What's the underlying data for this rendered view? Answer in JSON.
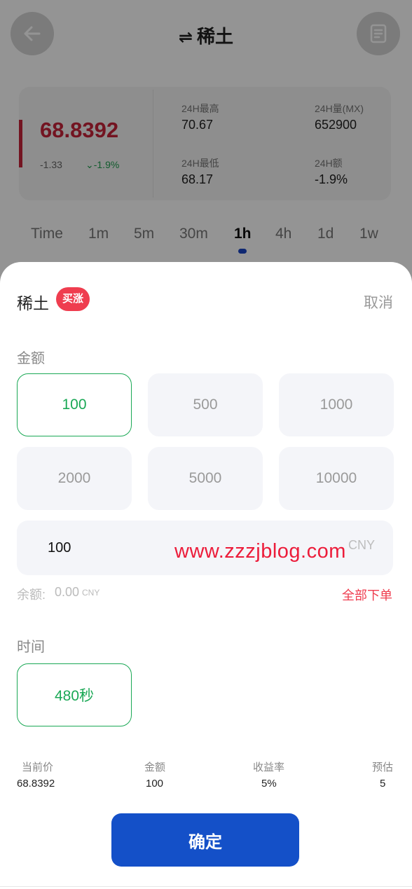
{
  "header": {
    "title": "稀土",
    "swap_glyph": "⇌",
    "back_icon": "arrow-left-icon",
    "orders_icon": "document-icon"
  },
  "ticker": {
    "price": "68.8392",
    "change_abs": "-1.33",
    "change_pct": "-1.9%",
    "change_arrow": "⌄",
    "stats": {
      "high_label": "24H最高",
      "high_value": "70.67",
      "volume_label": "24H量(MX)",
      "volume_value": "652900",
      "low_label": "24H最低",
      "low_value": "68.17",
      "amount_label": "24H额",
      "amount_value": "-1.9%"
    }
  },
  "intervals": [
    "Time",
    "1m",
    "5m",
    "30m",
    "1h",
    "4h",
    "1d",
    "1w"
  ],
  "active_interval": "1h",
  "sheet": {
    "title": "稀土",
    "badge": "买涨",
    "cancel": "取消",
    "amount_label": "金额",
    "amount_options": [
      "100",
      "500",
      "1000",
      "2000",
      "5000",
      "10000"
    ],
    "selected_amount": "100",
    "input_value": "100",
    "input_unit": "CNY",
    "watermark": "www.zzzjblog.com",
    "balance_label": "余额:",
    "balance_value": "0.00",
    "balance_unit": "CNY",
    "order_all": "全部下单",
    "time_label": "时间",
    "time_option": "480秒",
    "summary": {
      "price_label": "当前价",
      "price_value": "68.8392",
      "amount_label": "金额",
      "amount_value": "100",
      "rate_label": "收益率",
      "rate_value": "5%",
      "estimate_label": "预估",
      "estimate_value": "5"
    },
    "confirm": "确定"
  },
  "colors": {
    "accent_red": "#c7243a",
    "badge_red": "#ef3d4f",
    "green": "#1aa855",
    "primary_blue": "#1450c8"
  }
}
